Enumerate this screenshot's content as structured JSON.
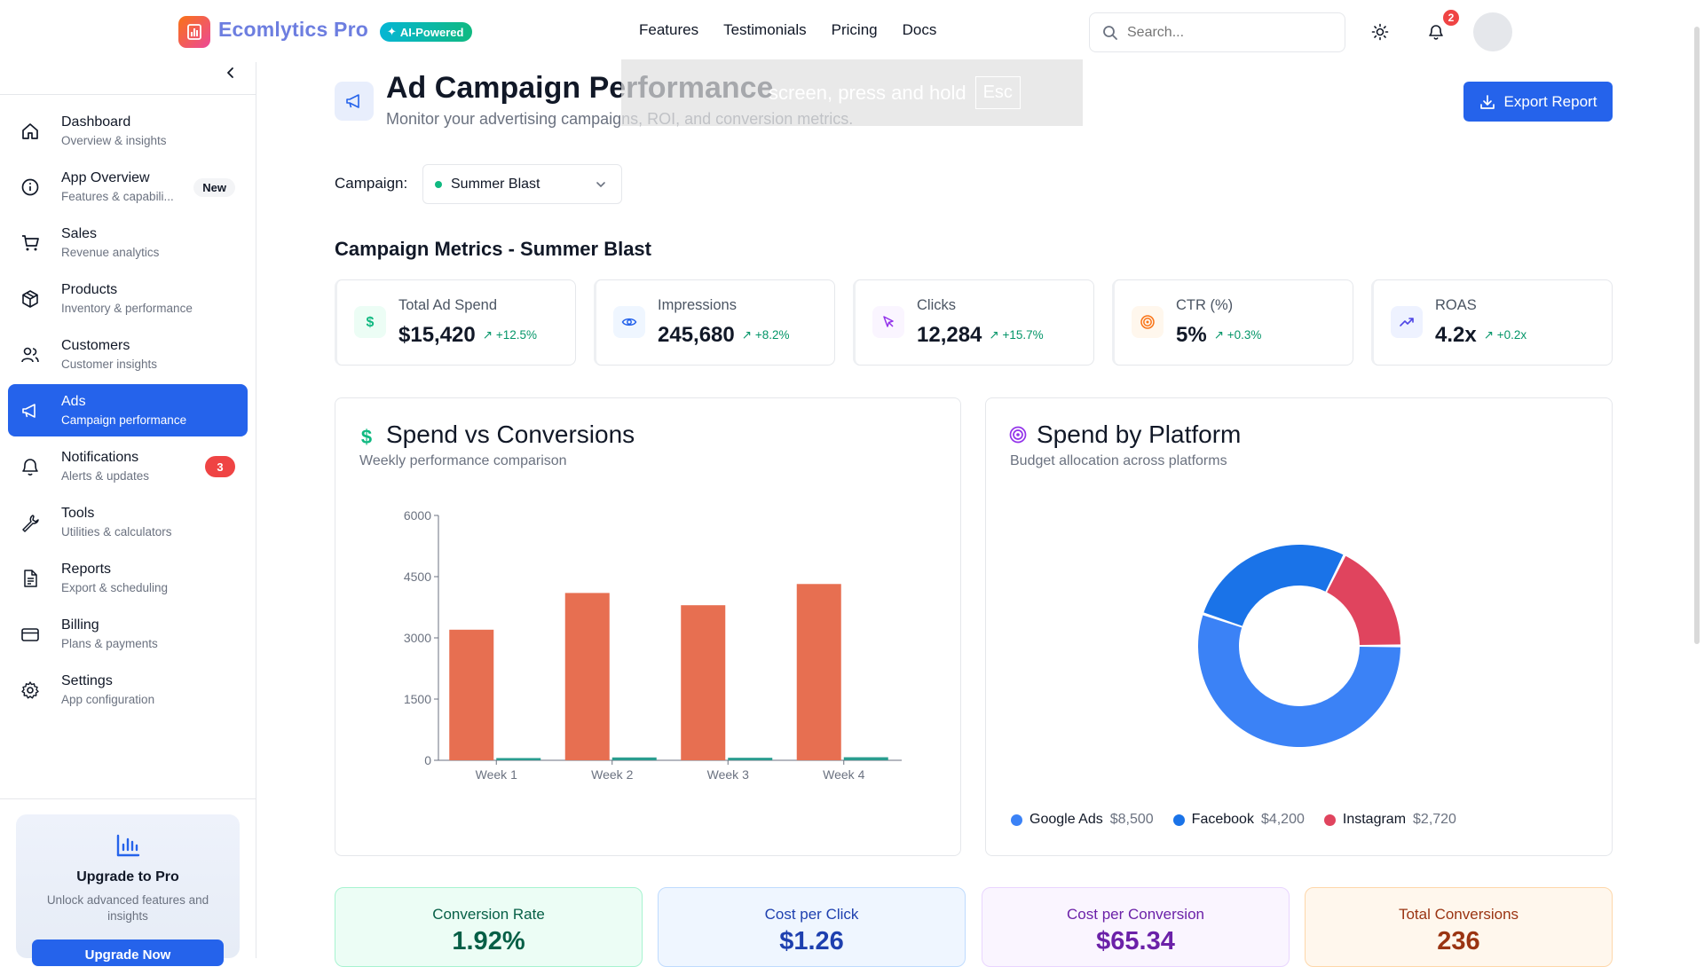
{
  "header": {
    "brand": "Ecomlytics Pro",
    "ai_badge": "AI-Powered",
    "nav": [
      "Features",
      "Testimonials",
      "Pricing",
      "Docs"
    ],
    "search_placeholder": "Search...",
    "notification_count": "2"
  },
  "sidebar": {
    "items": [
      {
        "label": "Dashboard",
        "sub": "Overview & insights",
        "icon": "home-icon"
      },
      {
        "label": "App Overview",
        "sub": "Features & capabili...",
        "icon": "info-icon",
        "badge": "New"
      },
      {
        "label": "Sales",
        "sub": "Revenue analytics",
        "icon": "cart-icon"
      },
      {
        "label": "Products",
        "sub": "Inventory & performance",
        "icon": "box-icon"
      },
      {
        "label": "Customers",
        "sub": "Customer insights",
        "icon": "users-icon"
      },
      {
        "label": "Ads",
        "sub": "Campaign performance",
        "icon": "megaphone-icon",
        "active": true
      },
      {
        "label": "Notifications",
        "sub": "Alerts & updates",
        "icon": "bell-icon",
        "badge": "3"
      },
      {
        "label": "Tools",
        "sub": "Utilities & calculators",
        "icon": "wrench-icon"
      },
      {
        "label": "Reports",
        "sub": "Export & scheduling",
        "icon": "file-icon"
      },
      {
        "label": "Billing",
        "sub": "Plans & payments",
        "icon": "card-icon"
      },
      {
        "label": "Settings",
        "sub": "App configuration",
        "icon": "gear-icon"
      }
    ],
    "upgrade": {
      "title": "Upgrade to Pro",
      "description": "Unlock advanced features and insights",
      "button": "Upgrade Now"
    }
  },
  "page": {
    "title": "Ad Campaign Performance",
    "subtitle": "Monitor your advertising campaigns, ROI, and conversion metrics.",
    "overlay_text": "screen, press and hold",
    "overlay_key": "Esc",
    "export_button": "Export Report",
    "campaign_label": "Campaign:",
    "campaign_selected": "Summer Blast",
    "metrics_title": "Campaign Metrics - Summer Blast"
  },
  "metrics": [
    {
      "label": "Total Ad Spend",
      "value": "$15,420",
      "change": "+12.5%",
      "icon": "dollar-icon",
      "color": "#10b981",
      "bg": "#ecfdf5"
    },
    {
      "label": "Impressions",
      "value": "245,680",
      "change": "+8.2%",
      "icon": "eye-icon",
      "color": "#2563eb",
      "bg": "#eff6ff"
    },
    {
      "label": "Clicks",
      "value": "12,284",
      "change": "+15.7%",
      "icon": "cursor-icon",
      "color": "#9333ea",
      "bg": "#faf5ff"
    },
    {
      "label": "CTR (%)",
      "value": "5%",
      "change": "+0.3%",
      "icon": "target-icon",
      "color": "#f97316",
      "bg": "#fff7ed"
    },
    {
      "label": "ROAS",
      "value": "4.2x",
      "change": "+0.2x",
      "icon": "trend-icon",
      "color": "#4f46e5",
      "bg": "#eef2ff"
    }
  ],
  "spend_chart": {
    "title": "Spend vs Conversions",
    "subtitle": "Weekly performance comparison"
  },
  "platform_chart": {
    "title": "Spend by Platform",
    "subtitle": "Budget allocation across platforms"
  },
  "chart_data": [
    {
      "type": "bar",
      "title": "Spend vs Conversions",
      "categories": [
        "Week 1",
        "Week 2",
        "Week 3",
        "Week 4"
      ],
      "series": [
        {
          "values": [
            3200,
            4100,
            3800,
            4320
          ],
          "color": "#e76f51"
        },
        {
          "values": [
            55,
            70,
            62,
            75
          ],
          "color": "#2a9d8f"
        }
      ],
      "ylim": [
        0,
        6000
      ],
      "yticks": [
        0,
        1500,
        3000,
        4500,
        6000
      ],
      "grid": false
    },
    {
      "type": "pie",
      "title": "Spend by Platform",
      "labels": [
        "Google Ads",
        "Facebook",
        "Instagram"
      ],
      "values": [
        8500,
        4200,
        2720
      ],
      "value_labels": [
        "$8,500",
        "$4,200",
        "$2,720"
      ],
      "colors": [
        "#3b82f6",
        "#1a73e8",
        "#e0445e"
      ],
      "legend": "bottom-left"
    }
  ],
  "kpis": [
    {
      "label": "Conversion Rate",
      "value": "1.92%",
      "text": "#065f46",
      "bg": "#ecfdf5",
      "border": "#a7f3d0"
    },
    {
      "label": "Cost per Click",
      "value": "$1.26",
      "text": "#1e40af",
      "bg": "#eff6ff",
      "border": "#bfdbfe"
    },
    {
      "label": "Cost per Conversion",
      "value": "$65.34",
      "text": "#6b21a8",
      "bg": "#faf5ff",
      "border": "#e9d5ff"
    },
    {
      "label": "Total Conversions",
      "value": "236",
      "text": "#9a3412",
      "bg": "#fff7ed",
      "border": "#fed7aa"
    }
  ]
}
